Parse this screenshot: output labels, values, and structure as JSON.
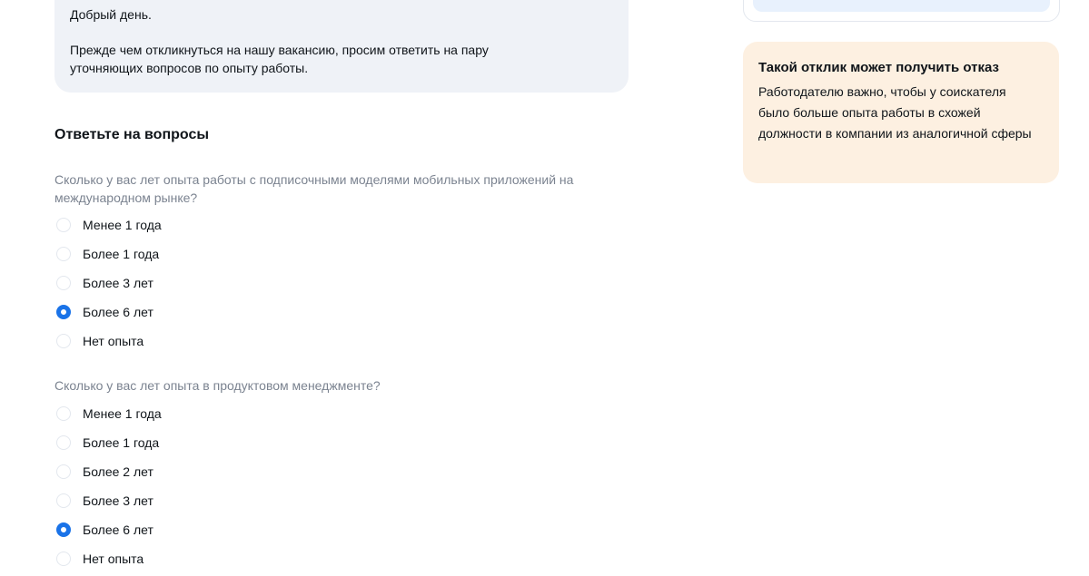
{
  "greeting": {
    "hello": "Добрый день.",
    "message": "Прежде чем откликнуться на нашу вакансию, просим ответить на пару уточняющих вопросов по опыту работы."
  },
  "questions_section": {
    "title": "Ответьте на вопросы",
    "questions": [
      {
        "text": "Сколько у вас лет опыта работы с подписочными моделями мобильных приложений на международном рынке?",
        "options": [
          "Менее 1 года",
          "Более 1 года",
          "Более 3 лет",
          "Более 6 лет",
          "Нет опыта"
        ],
        "selected": "Более 6 лет"
      },
      {
        "text": "Сколько у вас лет опыта в продуктовом менеджменте?",
        "options": [
          "Менее 1 года",
          "Более 1 года",
          "Более 2 лет",
          "Более 3 лет",
          "Более 6 лет",
          "Нет опыта"
        ],
        "selected": "Более 6 лет"
      }
    ]
  },
  "warning": {
    "title": "Такой отклик может получить отказ",
    "text": "Работодателю важно, чтобы у соискателя было больше опыта работы в схожей должности в компании из аналогичной сферы"
  },
  "colors": {
    "accent": "#1a73e8",
    "greeting_bg": "#eff2f7",
    "warning_bg": "#fdf0e1",
    "muted_text": "#7b8390"
  }
}
